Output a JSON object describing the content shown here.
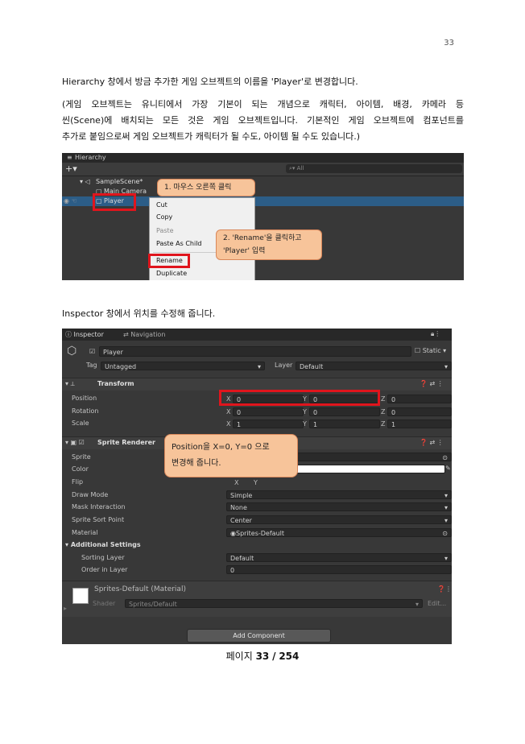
{
  "page": {
    "number": "33"
  },
  "text": {
    "para1": "Hierarchy 창에서 방금 추가한 게임 오브젝트의 이름을 'Player'로 변경합니다.",
    "para2_l1": "(게임 오브젝트는 유니티에서 가장 기본이 되는 개념으로 캐릭터, 아이템, 배경, 카메라 등",
    "para2_l2": "씬(Scene)에 배치되는 모든 것은 게임 오브젝트입니다. 기본적인 게임 오브젝트에 컴포넌트를",
    "para2_l3": "추가로 붙임으로써 게임 오브젝트가 캐릭터가 될 수도, 아이템 될 수도 있습니다.)",
    "para3": "Inspector 창에서 위치를 수정해 줍니다."
  },
  "hierarchy": {
    "tab": "Hierarchy",
    "search_placeholder": "All",
    "scene": "SampleScene*",
    "camera": "Main Camera",
    "player": "Player",
    "menu": [
      "Cut",
      "Copy",
      "Paste",
      "Paste As Child",
      "Rename",
      "Duplicate"
    ],
    "callout1": "1. 마우스 오른쪽 클릭",
    "callout2_l1": "2. 'Rename'을 클릭하고",
    "callout2_l2": "'Player' 입력"
  },
  "inspector": {
    "tab_inspector": "Inspector",
    "tab_navigation": "Navigation",
    "object_name": "Player",
    "static_label": "Static",
    "tag_label": "Tag",
    "tag_value": "Untagged",
    "layer_label": "Layer",
    "layer_value": "Default",
    "transform": {
      "title": "Transform",
      "position_label": "Position",
      "rotation_label": "Rotation",
      "scale_label": "Scale",
      "position": [
        "0",
        "0",
        "0"
      ],
      "rotation": [
        "0",
        "0",
        "0"
      ],
      "scale": [
        "1",
        "1",
        "1"
      ]
    },
    "sprite_renderer": {
      "title": "Sprite Renderer",
      "sprite_label": "Sprite",
      "color_label": "Color",
      "flip_label": "Flip",
      "flip_x": "X",
      "flip_y": "Y",
      "draw_mode_label": "Draw Mode",
      "draw_mode": "Simple",
      "mask_label": "Mask Interaction",
      "mask": "None",
      "sort_point_label": "Sprite Sort Point",
      "sort_point": "Center",
      "material_label": "Material",
      "material": "Sprites-Default",
      "additional": "Additional Settings",
      "sorting_layer_label": "Sorting Layer",
      "sorting_layer": "Default",
      "order_label": "Order in Layer",
      "order": "0"
    },
    "material_block": {
      "title": "Sprites-Default (Material)",
      "shader_label": "Shader",
      "shader": "Sprites/Default",
      "edit": "Edit..."
    },
    "add_component": "Add Component",
    "callout_l1": "Position을 X=0, Y=0 으로",
    "callout_l2": "변경해 줍니다."
  },
  "footer": {
    "prefix": "페이지",
    "current": "33",
    "sep": "/",
    "total": "254"
  },
  "colors": {
    "callout_fill": "#f7c49a",
    "highlight_red": "#e0151d",
    "selection_blue": "#2c5d87"
  }
}
